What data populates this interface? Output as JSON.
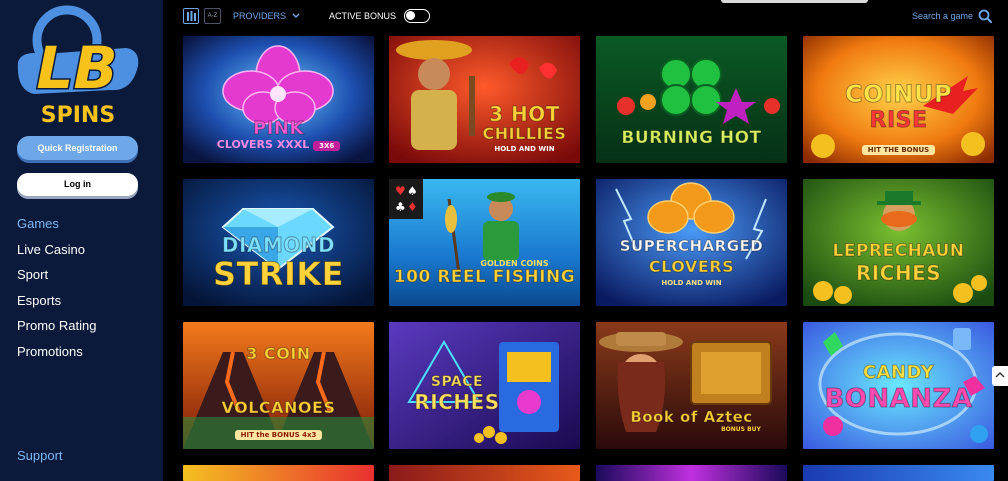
{
  "sidebar": {
    "logo_text": "LB",
    "logo_sub": "SPINS",
    "register_label": "Quick Registration",
    "login_label": "Log in",
    "nav": [
      "Games",
      "Live Casino",
      "Sport",
      "Esports",
      "Promo Rating",
      "Promotions"
    ],
    "support_label": "Support"
  },
  "toolbar": {
    "az_label": "A-Z",
    "providers_label": "PROVIDERS",
    "active_bonus_label": "ACTIVE BONUS",
    "active_bonus_on": false,
    "search_label": "Search a game"
  },
  "games": [
    {
      "title": "PINK",
      "line2": "CLOVERS XXXL",
      "badge": "3X6"
    },
    {
      "title": "3 HOT",
      "line2": "CHILLIES",
      "badge": "HOLD AND WIN"
    },
    {
      "title": "BURNING HOT",
      "line2": "",
      "badge": ""
    },
    {
      "title": "COINUP",
      "line2": "RISE",
      "badge": "HIT THE BONUS"
    },
    {
      "title": "DIAMOND",
      "line2": "STRIKE",
      "badge": ""
    },
    {
      "title": "GOLDEN COINS",
      "line2": "100 REEL FISHING",
      "badge": ""
    },
    {
      "title": "SUPERCHARGED",
      "line2": "CLOVERS",
      "badge": "HOLD AND WIN"
    },
    {
      "title": "LEPRECHAUN",
      "line2": "RICHES",
      "badge": ""
    },
    {
      "title": "3 COIN",
      "line2": "VOLCANOES",
      "badge": "HIT the BONUS 4x3"
    },
    {
      "title": "SPACE",
      "line2": "RICHES",
      "badge": ""
    },
    {
      "title": "Book of Aztec",
      "line2": "",
      "badge": "BONUS BUY"
    },
    {
      "title": "CANDY",
      "line2": "BONANZA",
      "badge": ""
    }
  ],
  "colors": {
    "sidebar_bg": "#0b1a3a",
    "accent": "#6fa8e8",
    "logo_yellow": "#f7c21a",
    "logo_blue": "#4d8fe0"
  }
}
